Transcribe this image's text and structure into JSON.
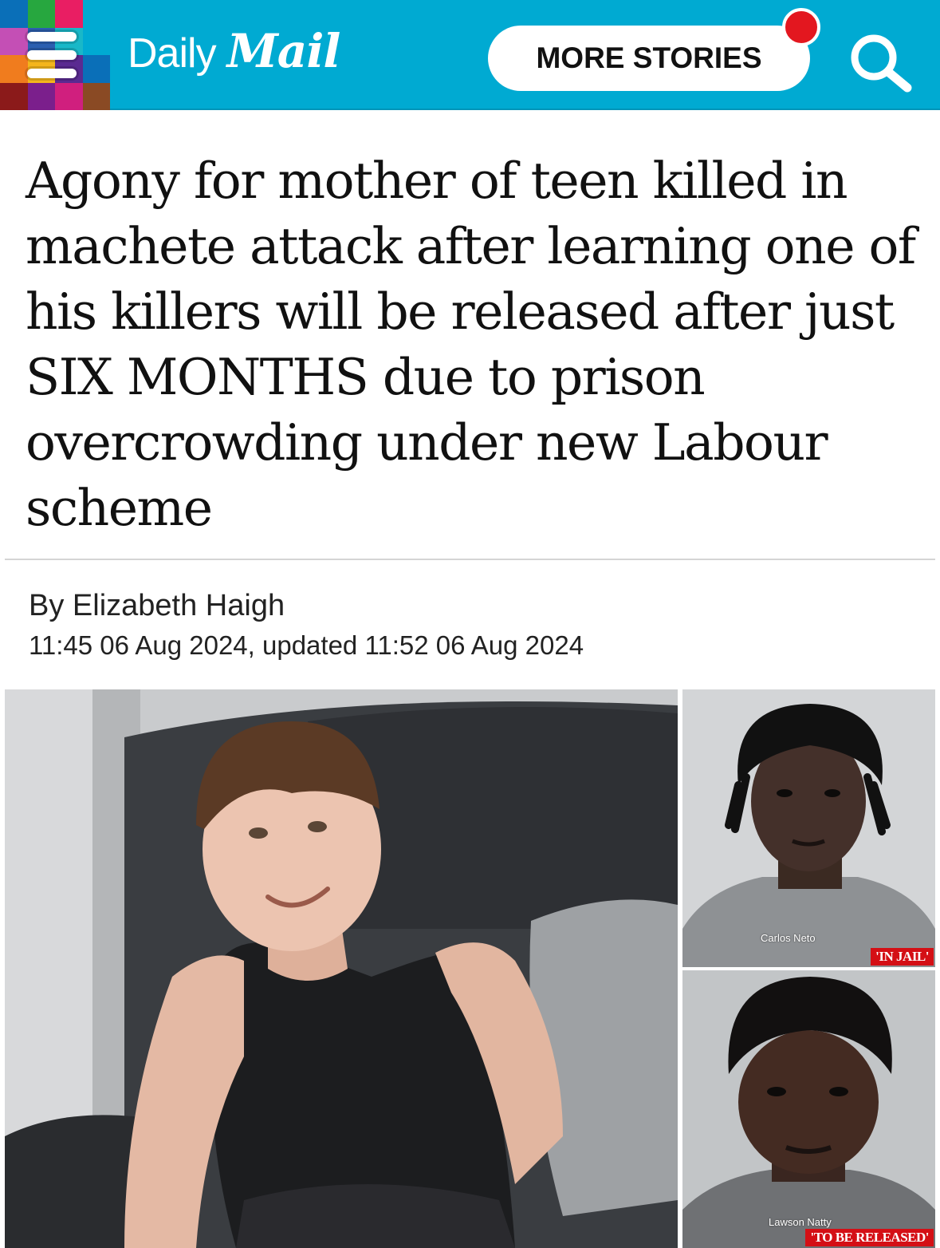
{
  "header": {
    "logo_daily": "Daily",
    "logo_mail": "Mail",
    "more_stories_label": "MORE STORIES",
    "brand_color": "#00aad2",
    "notification_color": "#e3171f",
    "icons": [
      "menu-icon",
      "search-icon",
      "notification-dot"
    ]
  },
  "article": {
    "headline": "Agony for mother of teen killed in machete attack after learning one of his killers will be released after just SIX MONTHS due to prison overcrowding under new Labour scheme",
    "byline_prefix": "By",
    "author": "Elizabeth Haigh",
    "dateline": "11:45 06 Aug 2024, updated 11:52 06 Aug 2024"
  },
  "images": {
    "top_right": {
      "name_caption": "Carlos Neto",
      "tag": "'IN JAIL'"
    },
    "bottom_right": {
      "name_caption": "Lawson Natty",
      "tag": "'TO BE RELEASED'"
    }
  }
}
